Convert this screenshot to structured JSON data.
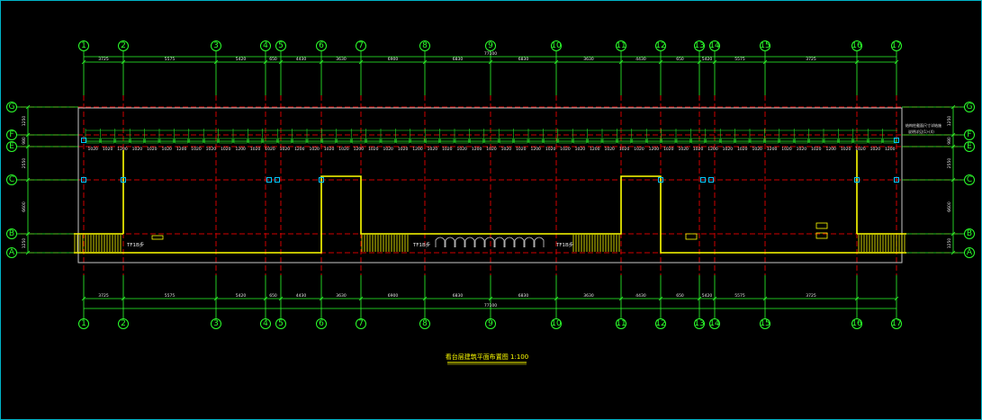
{
  "colors": {
    "background": "#000000",
    "frame": "#00b4c8",
    "grid_axis": "#d00000",
    "dimension": "#2cff2c",
    "wall": "#ffff00",
    "column": "#00c8ff",
    "text": "#e8e8e8"
  },
  "grid": {
    "columns": [
      "1",
      "2",
      "3",
      "4",
      "5",
      "6",
      "7",
      "8",
      "9",
      "10",
      "11",
      "12",
      "13",
      "14",
      "15",
      "16",
      "17"
    ],
    "rows": [
      "G",
      "F",
      "E",
      "C",
      "B",
      "A"
    ]
  },
  "dimensions": {
    "overall": "77100",
    "top_spans": [
      "3725",
      "5575",
      "5420",
      "650",
      "4430",
      "3630",
      "6900",
      "6830",
      "6830",
      "3630",
      "4430",
      "650",
      "5420",
      "5575",
      "3725"
    ],
    "bottom_spans": [
      "3725",
      "5575",
      "5420",
      "650",
      "4430",
      "3630",
      "6900",
      "6830",
      "6830",
      "3630",
      "4430",
      "650",
      "5420",
      "5575",
      "3725"
    ],
    "left_spans": [
      "1250",
      "980",
      "2550",
      "6600",
      "1250"
    ],
    "right_spans": [
      "1250",
      "980",
      "2550",
      "6600",
      "1250"
    ],
    "row_f_detail": [
      "1020",
      "1020",
      "1200",
      "1020",
      "1020",
      "1020",
      "1200",
      "1020",
      "1020",
      "1020",
      "1200",
      "1020",
      "1020",
      "1020",
      "1200",
      "1020",
      "1020",
      "1020",
      "1200",
      "1020",
      "1020",
      "1020",
      "1200",
      "1020",
      "1020",
      "1020",
      "1200",
      "1020",
      "1020",
      "1020",
      "1200",
      "1020",
      "1020",
      "1020",
      "1200",
      "1020",
      "1020",
      "1020",
      "1200",
      "1020",
      "1020",
      "1020",
      "1200",
      "1020",
      "1020",
      "1020",
      "1200",
      "1020",
      "1020",
      "1020",
      "1200",
      "1020",
      "1020",
      "1020",
      "1200"
    ]
  },
  "labels": {
    "stair_left": "TF1B步",
    "stair_mid": "TF1B步",
    "stair_right": "TF1B步",
    "note_right_1": "结构柱截面尺寸详结施",
    "note_right_2": "说明详见(1)-(4)",
    "drawing_title": "看台层建筑平面布置图 1:100"
  }
}
